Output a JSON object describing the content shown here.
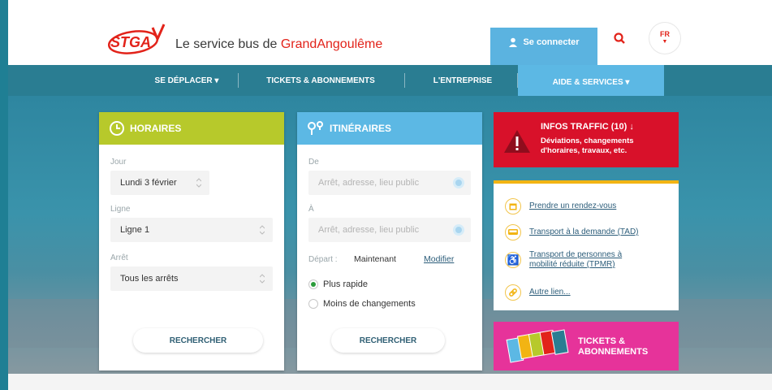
{
  "header": {
    "logo_text": "STGA",
    "tagline_prefix": "Le service bus de ",
    "tagline_brand": "GrandAngoulême",
    "connect_label": "Se connecter",
    "lang": "FR"
  },
  "nav": {
    "items": [
      {
        "label": "SE DÉPLACER ▾"
      },
      {
        "label": "TICKETS & ABONNEMENTS"
      },
      {
        "label": "L'ENTREPRISE"
      },
      {
        "label": "AIDE & SERVICES ▾"
      }
    ]
  },
  "horaires": {
    "title": "HORAIRES",
    "color": "#b7c92b",
    "jour_label": "Jour",
    "jour_value": "Lundi 3 février",
    "ligne_label": "Ligne",
    "ligne_value": "Ligne 1",
    "arret_label": "Arrêt",
    "arret_value": "Tous les arrêts",
    "search_label": "RECHERCHER"
  },
  "itineraires": {
    "title": "ITINÉRAIRES",
    "color": "#5cb8e4",
    "de_label": "De",
    "de_placeholder": "Arrêt, adresse, lieu public",
    "a_label": "À",
    "a_placeholder": "Arrêt, adresse, lieu public",
    "depart_label": "Départ :",
    "depart_value": "Maintenant",
    "modify_label": "Modifier",
    "option_fast": "Plus rapide",
    "option_less": "Moins de changements",
    "search_label": "RECHERCHER"
  },
  "traffic": {
    "title": "INFOS TRAFFIC (10) ↓",
    "description": "Déviations, changements d'horaires, travaux, etc.",
    "color": "#d8112a"
  },
  "quick_links": [
    {
      "label": "Prendre un rendez-vous",
      "icon": "calendar-icon"
    },
    {
      "label": "Transport à la demande (TAD)",
      "icon": "bus-icon"
    },
    {
      "label": "Transport de personnes à mobilité réduite (TPMR)",
      "icon": "wheelchair-icon"
    },
    {
      "label": "Autre lien...",
      "icon": "link-icon"
    }
  ],
  "tickets": {
    "title": "TICKETS & ABONNEMENTS",
    "color": "#e6339a"
  }
}
